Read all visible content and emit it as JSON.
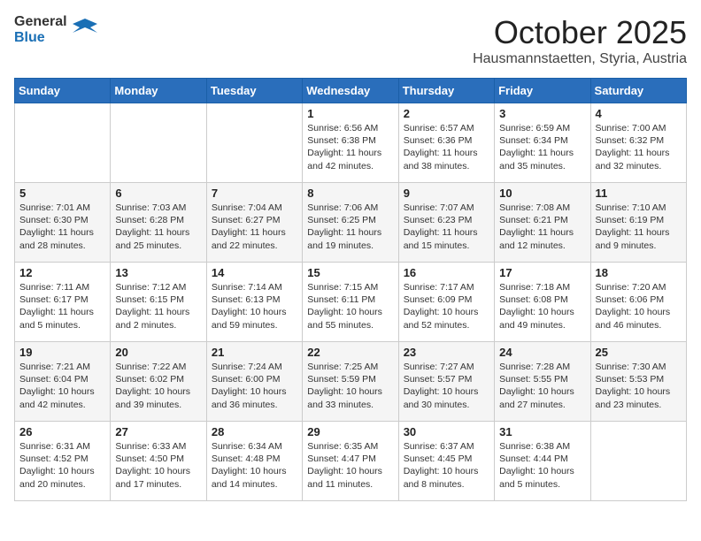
{
  "header": {
    "logo_general": "General",
    "logo_blue": "Blue",
    "month": "October 2025",
    "location": "Hausmannstaetten, Styria, Austria"
  },
  "weekdays": [
    "Sunday",
    "Monday",
    "Tuesday",
    "Wednesday",
    "Thursday",
    "Friday",
    "Saturday"
  ],
  "weeks": [
    [
      {
        "day": "",
        "detail": ""
      },
      {
        "day": "",
        "detail": ""
      },
      {
        "day": "",
        "detail": ""
      },
      {
        "day": "1",
        "detail": "Sunrise: 6:56 AM\nSunset: 6:38 PM\nDaylight: 11 hours\nand 42 minutes."
      },
      {
        "day": "2",
        "detail": "Sunrise: 6:57 AM\nSunset: 6:36 PM\nDaylight: 11 hours\nand 38 minutes."
      },
      {
        "day": "3",
        "detail": "Sunrise: 6:59 AM\nSunset: 6:34 PM\nDaylight: 11 hours\nand 35 minutes."
      },
      {
        "day": "4",
        "detail": "Sunrise: 7:00 AM\nSunset: 6:32 PM\nDaylight: 11 hours\nand 32 minutes."
      }
    ],
    [
      {
        "day": "5",
        "detail": "Sunrise: 7:01 AM\nSunset: 6:30 PM\nDaylight: 11 hours\nand 28 minutes."
      },
      {
        "day": "6",
        "detail": "Sunrise: 7:03 AM\nSunset: 6:28 PM\nDaylight: 11 hours\nand 25 minutes."
      },
      {
        "day": "7",
        "detail": "Sunrise: 7:04 AM\nSunset: 6:27 PM\nDaylight: 11 hours\nand 22 minutes."
      },
      {
        "day": "8",
        "detail": "Sunrise: 7:06 AM\nSunset: 6:25 PM\nDaylight: 11 hours\nand 19 minutes."
      },
      {
        "day": "9",
        "detail": "Sunrise: 7:07 AM\nSunset: 6:23 PM\nDaylight: 11 hours\nand 15 minutes."
      },
      {
        "day": "10",
        "detail": "Sunrise: 7:08 AM\nSunset: 6:21 PM\nDaylight: 11 hours\nand 12 minutes."
      },
      {
        "day": "11",
        "detail": "Sunrise: 7:10 AM\nSunset: 6:19 PM\nDaylight: 11 hours\nand 9 minutes."
      }
    ],
    [
      {
        "day": "12",
        "detail": "Sunrise: 7:11 AM\nSunset: 6:17 PM\nDaylight: 11 hours\nand 5 minutes."
      },
      {
        "day": "13",
        "detail": "Sunrise: 7:12 AM\nSunset: 6:15 PM\nDaylight: 11 hours\nand 2 minutes."
      },
      {
        "day": "14",
        "detail": "Sunrise: 7:14 AM\nSunset: 6:13 PM\nDaylight: 10 hours\nand 59 minutes."
      },
      {
        "day": "15",
        "detail": "Sunrise: 7:15 AM\nSunset: 6:11 PM\nDaylight: 10 hours\nand 55 minutes."
      },
      {
        "day": "16",
        "detail": "Sunrise: 7:17 AM\nSunset: 6:09 PM\nDaylight: 10 hours\nand 52 minutes."
      },
      {
        "day": "17",
        "detail": "Sunrise: 7:18 AM\nSunset: 6:08 PM\nDaylight: 10 hours\nand 49 minutes."
      },
      {
        "day": "18",
        "detail": "Sunrise: 7:20 AM\nSunset: 6:06 PM\nDaylight: 10 hours\nand 46 minutes."
      }
    ],
    [
      {
        "day": "19",
        "detail": "Sunrise: 7:21 AM\nSunset: 6:04 PM\nDaylight: 10 hours\nand 42 minutes."
      },
      {
        "day": "20",
        "detail": "Sunrise: 7:22 AM\nSunset: 6:02 PM\nDaylight: 10 hours\nand 39 minutes."
      },
      {
        "day": "21",
        "detail": "Sunrise: 7:24 AM\nSunset: 6:00 PM\nDaylight: 10 hours\nand 36 minutes."
      },
      {
        "day": "22",
        "detail": "Sunrise: 7:25 AM\nSunset: 5:59 PM\nDaylight: 10 hours\nand 33 minutes."
      },
      {
        "day": "23",
        "detail": "Sunrise: 7:27 AM\nSunset: 5:57 PM\nDaylight: 10 hours\nand 30 minutes."
      },
      {
        "day": "24",
        "detail": "Sunrise: 7:28 AM\nSunset: 5:55 PM\nDaylight: 10 hours\nand 27 minutes."
      },
      {
        "day": "25",
        "detail": "Sunrise: 7:30 AM\nSunset: 5:53 PM\nDaylight: 10 hours\nand 23 minutes."
      }
    ],
    [
      {
        "day": "26",
        "detail": "Sunrise: 6:31 AM\nSunset: 4:52 PM\nDaylight: 10 hours\nand 20 minutes."
      },
      {
        "day": "27",
        "detail": "Sunrise: 6:33 AM\nSunset: 4:50 PM\nDaylight: 10 hours\nand 17 minutes."
      },
      {
        "day": "28",
        "detail": "Sunrise: 6:34 AM\nSunset: 4:48 PM\nDaylight: 10 hours\nand 14 minutes."
      },
      {
        "day": "29",
        "detail": "Sunrise: 6:35 AM\nSunset: 4:47 PM\nDaylight: 10 hours\nand 11 minutes."
      },
      {
        "day": "30",
        "detail": "Sunrise: 6:37 AM\nSunset: 4:45 PM\nDaylight: 10 hours\nand 8 minutes."
      },
      {
        "day": "31",
        "detail": "Sunrise: 6:38 AM\nSunset: 4:44 PM\nDaylight: 10 hours\nand 5 minutes."
      },
      {
        "day": "",
        "detail": ""
      }
    ]
  ]
}
